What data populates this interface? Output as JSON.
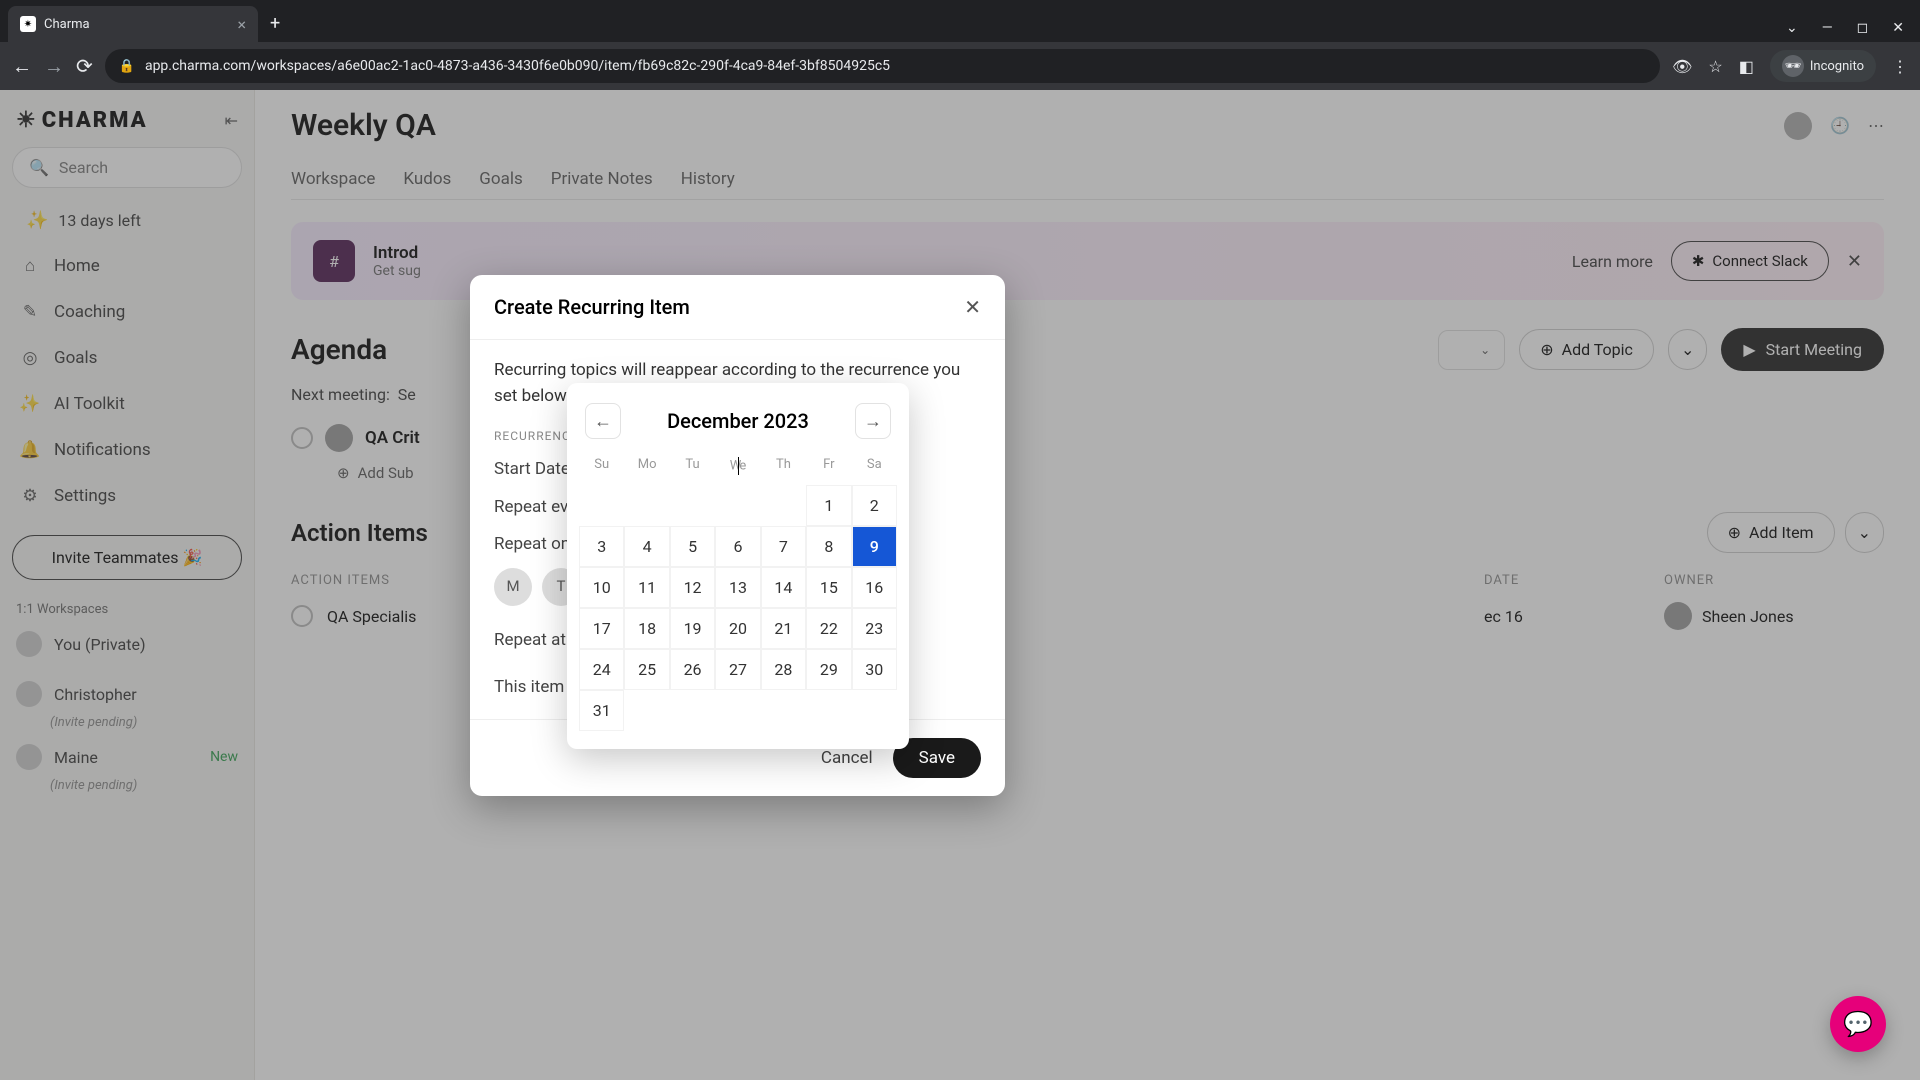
{
  "browser": {
    "tab_title": "Charma",
    "url": "app.charma.com/workspaces/a6e00ac2-1ac0-4873-a436-3430f6e0b090/item/fb69c82c-290f-4ca9-84ef-3bf8504925c5",
    "incognito_label": "Incognito"
  },
  "sidebar": {
    "logo_text": "CHARMA",
    "search_placeholder": "Search",
    "trial_text": "13 days left",
    "nav": [
      {
        "icon": "⌂",
        "label": "Home"
      },
      {
        "icon": "✎",
        "label": "Coaching"
      },
      {
        "icon": "◎",
        "label": "Goals"
      },
      {
        "icon": "✨",
        "label": "AI Toolkit"
      },
      {
        "icon": "🔔",
        "label": "Notifications"
      },
      {
        "icon": "⚙",
        "label": "Settings"
      }
    ],
    "invite_label": "Invite Teammates 🎉",
    "ws_header": "1:1 Workspaces",
    "ws_items": [
      {
        "name": "You (Private)",
        "pending": false,
        "new": false
      },
      {
        "name": "Christopher",
        "pending": true,
        "new": false
      },
      {
        "name": "Maine",
        "pending": true,
        "new": true
      }
    ],
    "pending_label": "(Invite pending)",
    "new_label": "New"
  },
  "main": {
    "title": "Weekly QA",
    "tabs": [
      "Workspace",
      "Kudos",
      "Goals",
      "Private Notes",
      "History"
    ],
    "banner": {
      "title_prefix": "Introd",
      "sub_prefix": "Get sug",
      "learn": "Learn more",
      "connect": "Connect Slack"
    },
    "agenda": {
      "title": "Agenda",
      "sort_prefix": "",
      "add_topic": "Add Topic",
      "start_meeting": "Start Meeting",
      "next_meeting_label": "Next meeting:",
      "next_meeting_value": "Se",
      "topic_title": "QA Crit",
      "add_subtopic": "Add Sub"
    },
    "action_items": {
      "title": "Action Items",
      "add_item": "Add Item",
      "columns": {
        "c1": "ACTION ITEMS",
        "c2": "DATE",
        "c3": "OWNER"
      },
      "row": {
        "title": "QA Specialis",
        "date": "ec 16",
        "owner": "Sheen Jones"
      }
    }
  },
  "modal": {
    "title": "Create Recurring Item",
    "description": "Recurring topics will reappear according to the recurrence you set below.",
    "section_label": "RECURRENCE",
    "start_date_label": "Start Date",
    "repeat_every_label": "Repeat eve",
    "repeat_on_label": "Repeat on",
    "day_chips": [
      "M",
      "T"
    ],
    "repeat_at_label": "Repeat at",
    "summary_prefix": "This item w",
    "cancel": "Cancel",
    "save": "Save"
  },
  "datepicker": {
    "month": "December 2023",
    "dow": [
      "Su",
      "Mo",
      "Tu",
      "We",
      "Th",
      "Fr",
      "Sa"
    ],
    "leading_empty": 5,
    "days": 31,
    "selected": 9
  }
}
